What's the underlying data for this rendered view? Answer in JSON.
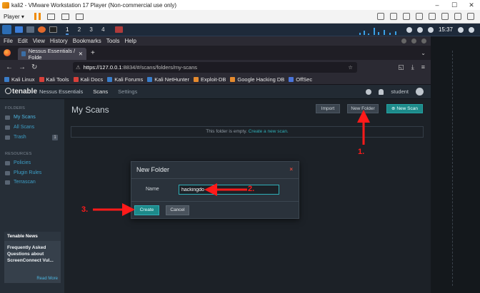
{
  "vm": {
    "title": "kali2 - VMware Workstation 17 Player (Non-commercial use only)",
    "player_menu": "Player ▾"
  },
  "taskbar": {
    "workspaces": [
      "1",
      "2",
      "3",
      "4"
    ],
    "clock": "15:37"
  },
  "firefox": {
    "menu": [
      "File",
      "Edit",
      "View",
      "History",
      "Bookmarks",
      "Tools",
      "Help"
    ],
    "tab_title": "Nessus Essentials / Folde",
    "url_host": "https://127.0.0.1",
    "url_rest": ":8834/#/scans/folders/my-scans",
    "bookmarks": [
      "Kali Linux",
      "Kali Tools",
      "Kali Docs",
      "Kali Forums",
      "Kali NetHunter",
      "Exploit-DB",
      "Google Hacking DB",
      "OffSec"
    ]
  },
  "nessus": {
    "logo": "tenable",
    "product": "Nessus Essentials",
    "nav_scans": "Scans",
    "nav_settings": "Settings",
    "user": "student",
    "sidebar": {
      "folders_header": "FOLDERS",
      "my_scans": "My Scans",
      "all_scans": "All Scans",
      "trash": "Trash",
      "trash_count": "1",
      "resources_header": "RESOURCES",
      "policies": "Policies",
      "plugin_rules": "Plugin Rules",
      "terrascan": "Terrascan"
    },
    "news": {
      "title": "Tenable News",
      "body": "Frequently Asked Questions about ScreenConnect Vul...",
      "more": "Read More"
    },
    "main": {
      "title": "My Scans",
      "import": "Import",
      "new_folder": "New Folder",
      "new_scan": "New Scan",
      "empty_text": "This folder is empty.",
      "empty_link": "Create a new scan."
    },
    "modal": {
      "title": "New Folder",
      "close": "×",
      "name_label": "Name",
      "name_value": "hackingdo",
      "create": "Create",
      "cancel": "Cancel"
    }
  },
  "annotations": {
    "step1": "1.",
    "step2": "2.",
    "step3": "3."
  },
  "colors": {
    "accent": "#1d8a8a",
    "annotation": "#ff1a1a"
  }
}
